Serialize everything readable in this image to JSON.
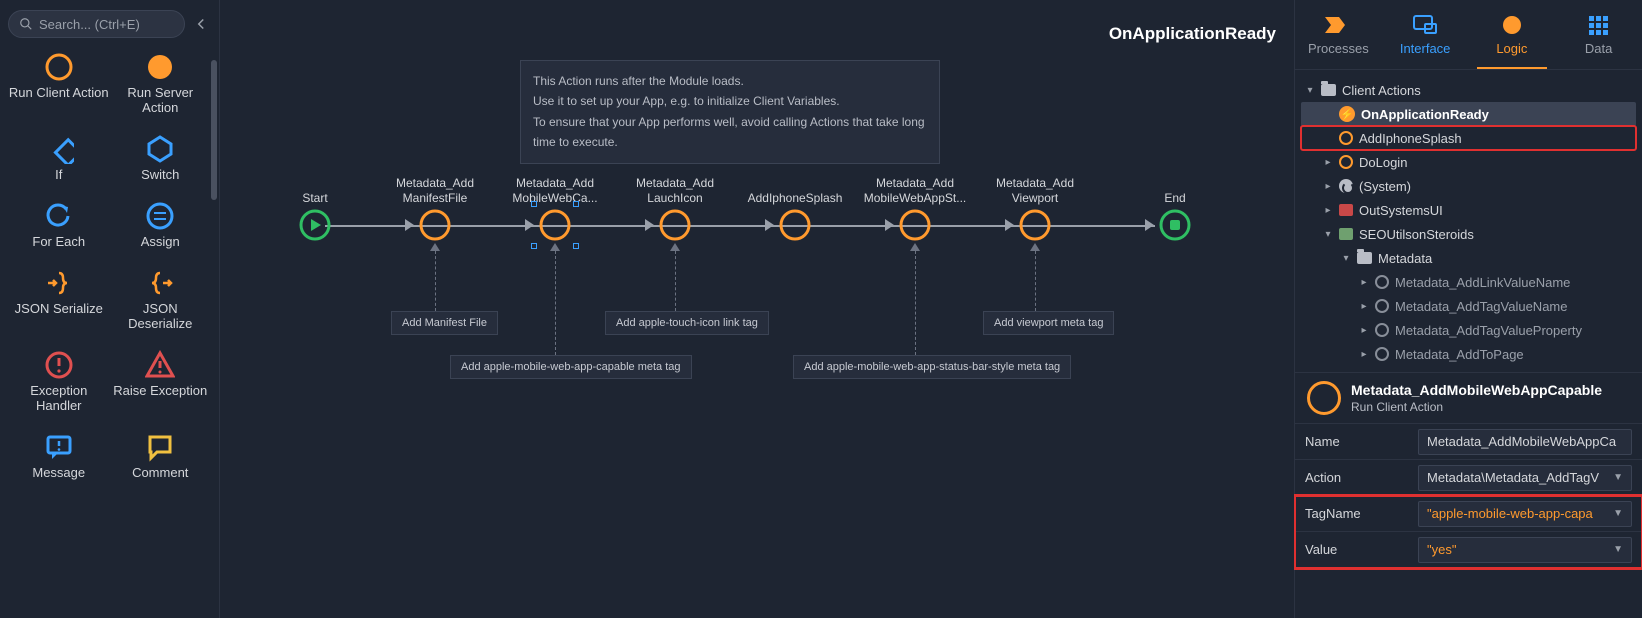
{
  "search": {
    "placeholder": "Search... (Ctrl+E)"
  },
  "toolbox": [
    {
      "key": "run-client-action",
      "label": "Run Client Action"
    },
    {
      "key": "run-server-action",
      "label": "Run Server Action"
    },
    {
      "key": "if",
      "label": "If"
    },
    {
      "key": "switch",
      "label": "Switch"
    },
    {
      "key": "for-each",
      "label": "For Each"
    },
    {
      "key": "assign",
      "label": "Assign"
    },
    {
      "key": "json-serialize",
      "label": "JSON Serialize"
    },
    {
      "key": "json-deserialize",
      "label": "JSON Deserialize"
    },
    {
      "key": "exception-handler",
      "label": "Exception Handler"
    },
    {
      "key": "raise-exception",
      "label": "Raise Exception"
    },
    {
      "key": "message",
      "label": "Message"
    },
    {
      "key": "comment",
      "label": "Comment"
    }
  ],
  "canvas": {
    "title": "OnApplicationReady",
    "hint_lines": [
      "This Action runs after the Module loads.",
      "Use it to set up your App, e.g. to initialize Client Variables.",
      "To ensure that your App performs well, avoid calling Actions that take long time to execute."
    ],
    "nodes": {
      "start": "Start",
      "manifest": {
        "l1": "Metadata_Add",
        "l2": "ManifestFile"
      },
      "capable": {
        "l1": "Metadata_Add",
        "l2": "MobileWebCa..."
      },
      "launch": {
        "l1": "Metadata_Add",
        "l2": "LauchIcon"
      },
      "splash": {
        "l1": "",
        "l2": "AddIphoneSplash"
      },
      "status": {
        "l1": "Metadata_Add",
        "l2": "MobileWebAppSt..."
      },
      "viewport": {
        "l1": "Metadata_Add",
        "l2": "Viewport"
      },
      "end": "End"
    },
    "comments": {
      "manifest": "Add Manifest File",
      "capable": "Add apple-mobile-web-app-capable meta tag",
      "launch": "Add apple-touch-icon  link tag",
      "status": "Add apple-mobile-web-app-status-bar-style meta tag",
      "viewport": "Add viewport meta tag"
    }
  },
  "tabs": {
    "processes": "Processes",
    "interface": "Interface",
    "logic": "Logic",
    "data": "Data"
  },
  "tree": {
    "root": "Client Actions",
    "on_app_ready": "OnApplicationReady",
    "add_splash": "AddIphoneSplash",
    "do_login": "DoLogin",
    "system": "(System)",
    "outsystems_ui": "OutSystemsUI",
    "seo": "SEOUtilsonSteroids",
    "metadata": "Metadata",
    "children": [
      "Metadata_AddLinkValueName",
      "Metadata_AddTagValueName",
      "Metadata_AddTagValueProperty",
      "Metadata_AddToPage"
    ]
  },
  "props": {
    "title": "Metadata_AddMobileWebAppCapable",
    "subtitle": "Run Client Action",
    "rows": {
      "name": {
        "label": "Name",
        "value": "Metadata_AddMobileWebAppCa"
      },
      "action": {
        "label": "Action",
        "value": "Metadata\\Metadata_AddTagV"
      },
      "tagname": {
        "label": "TagName",
        "value": "\"apple-mobile-web-app-capa"
      },
      "optvalue": {
        "label": "Value",
        "value": "\"yes\""
      }
    }
  }
}
